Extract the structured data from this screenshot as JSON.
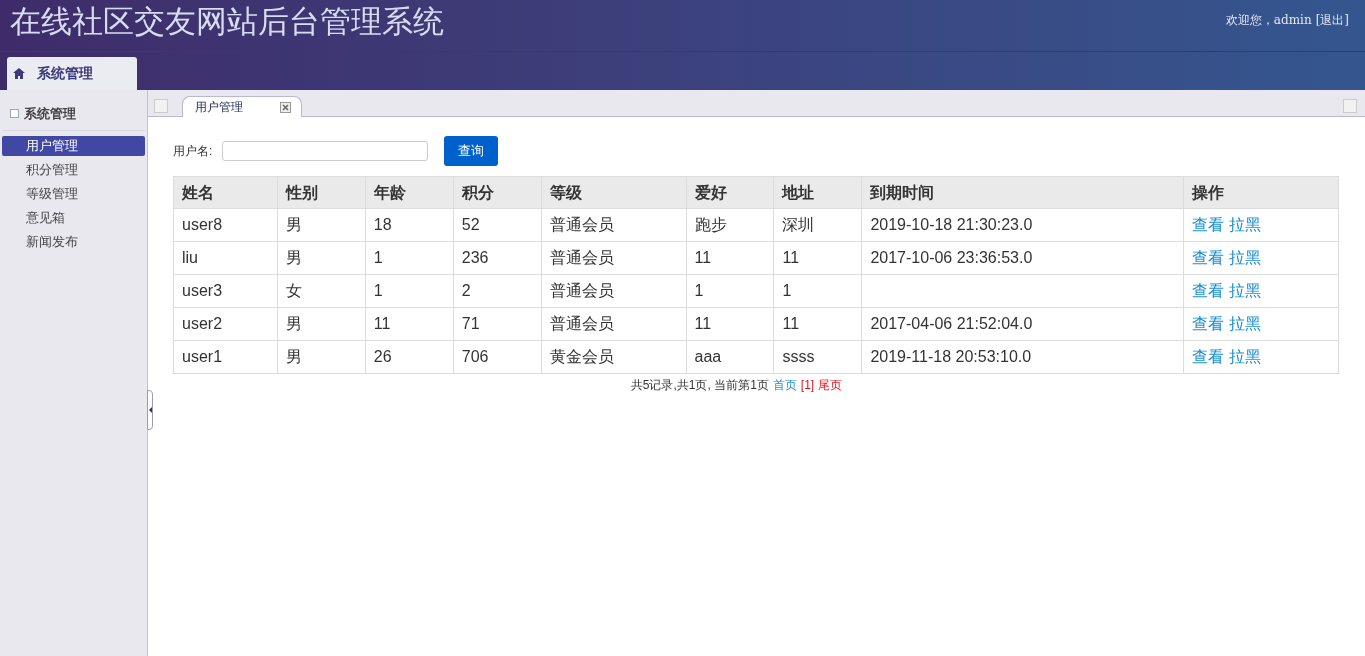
{
  "header": {
    "title": "在线社区交友网站后台管理系统",
    "welcome": "欢迎您，admin",
    "logout": "[退出]"
  },
  "top_tabs": [
    {
      "label": "系统管理",
      "selected": true
    }
  ],
  "sidebar": {
    "title": "系统管理",
    "items": [
      {
        "label": "用户管理",
        "selected": true
      },
      {
        "label": "积分管理",
        "selected": false
      },
      {
        "label": "等级管理",
        "selected": false
      },
      {
        "label": "意见箱",
        "selected": false
      },
      {
        "label": "新闻发布",
        "selected": false
      }
    ]
  },
  "tabs": [
    {
      "label": "用户管理",
      "selected": true
    }
  ],
  "search": {
    "label": "用户名:",
    "button": "查询"
  },
  "table": {
    "columns": [
      "姓名",
      "性别",
      "年龄",
      "积分",
      "等级",
      "爱好",
      "地址",
      "到期时间",
      "操作"
    ],
    "rows": [
      {
        "cells": [
          "user8",
          "男",
          "18",
          "52",
          "普通会员",
          "跑步",
          "深圳",
          "2019-10-18 21:30:23.0"
        ],
        "actions": [
          "查看",
          "拉黑"
        ]
      },
      {
        "cells": [
          "liu",
          "男",
          "1",
          "236",
          "普通会员",
          "11",
          "11",
          "2017-10-06 23:36:53.0"
        ],
        "actions": [
          "查看",
          "拉黑"
        ]
      },
      {
        "cells": [
          "user3",
          "女",
          "1",
          "2",
          "普通会员",
          "1",
          "1",
          ""
        ],
        "actions": [
          "查看",
          "拉黑"
        ]
      },
      {
        "cells": [
          "user2",
          "男",
          "11",
          "71",
          "普通会员",
          "11",
          "11",
          "2017-04-06 21:52:04.0"
        ],
        "actions": [
          "查看",
          "拉黑"
        ]
      },
      {
        "cells": [
          "user1",
          "男",
          "26",
          "706",
          "黄金会员",
          "aaa",
          "ssss",
          "2019-11-18 20:53:10.0"
        ],
        "actions": [
          "查看",
          "拉黑"
        ]
      }
    ]
  },
  "pagination": {
    "summary": "共5记录,共1页, 当前第1页",
    "first": "首页",
    "current": "[1]",
    "last": "尾页"
  }
}
